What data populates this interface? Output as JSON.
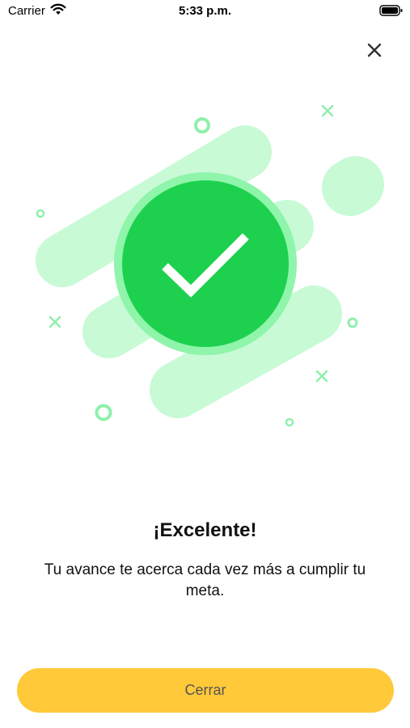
{
  "status_bar": {
    "carrier": "Carrier",
    "time": "5:33 p.m.",
    "icons": [
      "wifi-icon",
      "battery-icon"
    ]
  },
  "header": {
    "close_icon": "close-icon"
  },
  "illustration": {
    "icon": "checkmark-icon",
    "colors": {
      "circle": "#1DD14F",
      "circle_ring": "#8FF5AA",
      "shapes": "#C8FAD6",
      "decorations": "#8EF0AC",
      "check": "#ffffff"
    }
  },
  "content": {
    "title": "¡Excelente!",
    "message": "Tu avance te acerca cada vez más a cumplir tu meta."
  },
  "footer": {
    "button_label": "Cerrar",
    "button_color": "#FFC93A"
  }
}
